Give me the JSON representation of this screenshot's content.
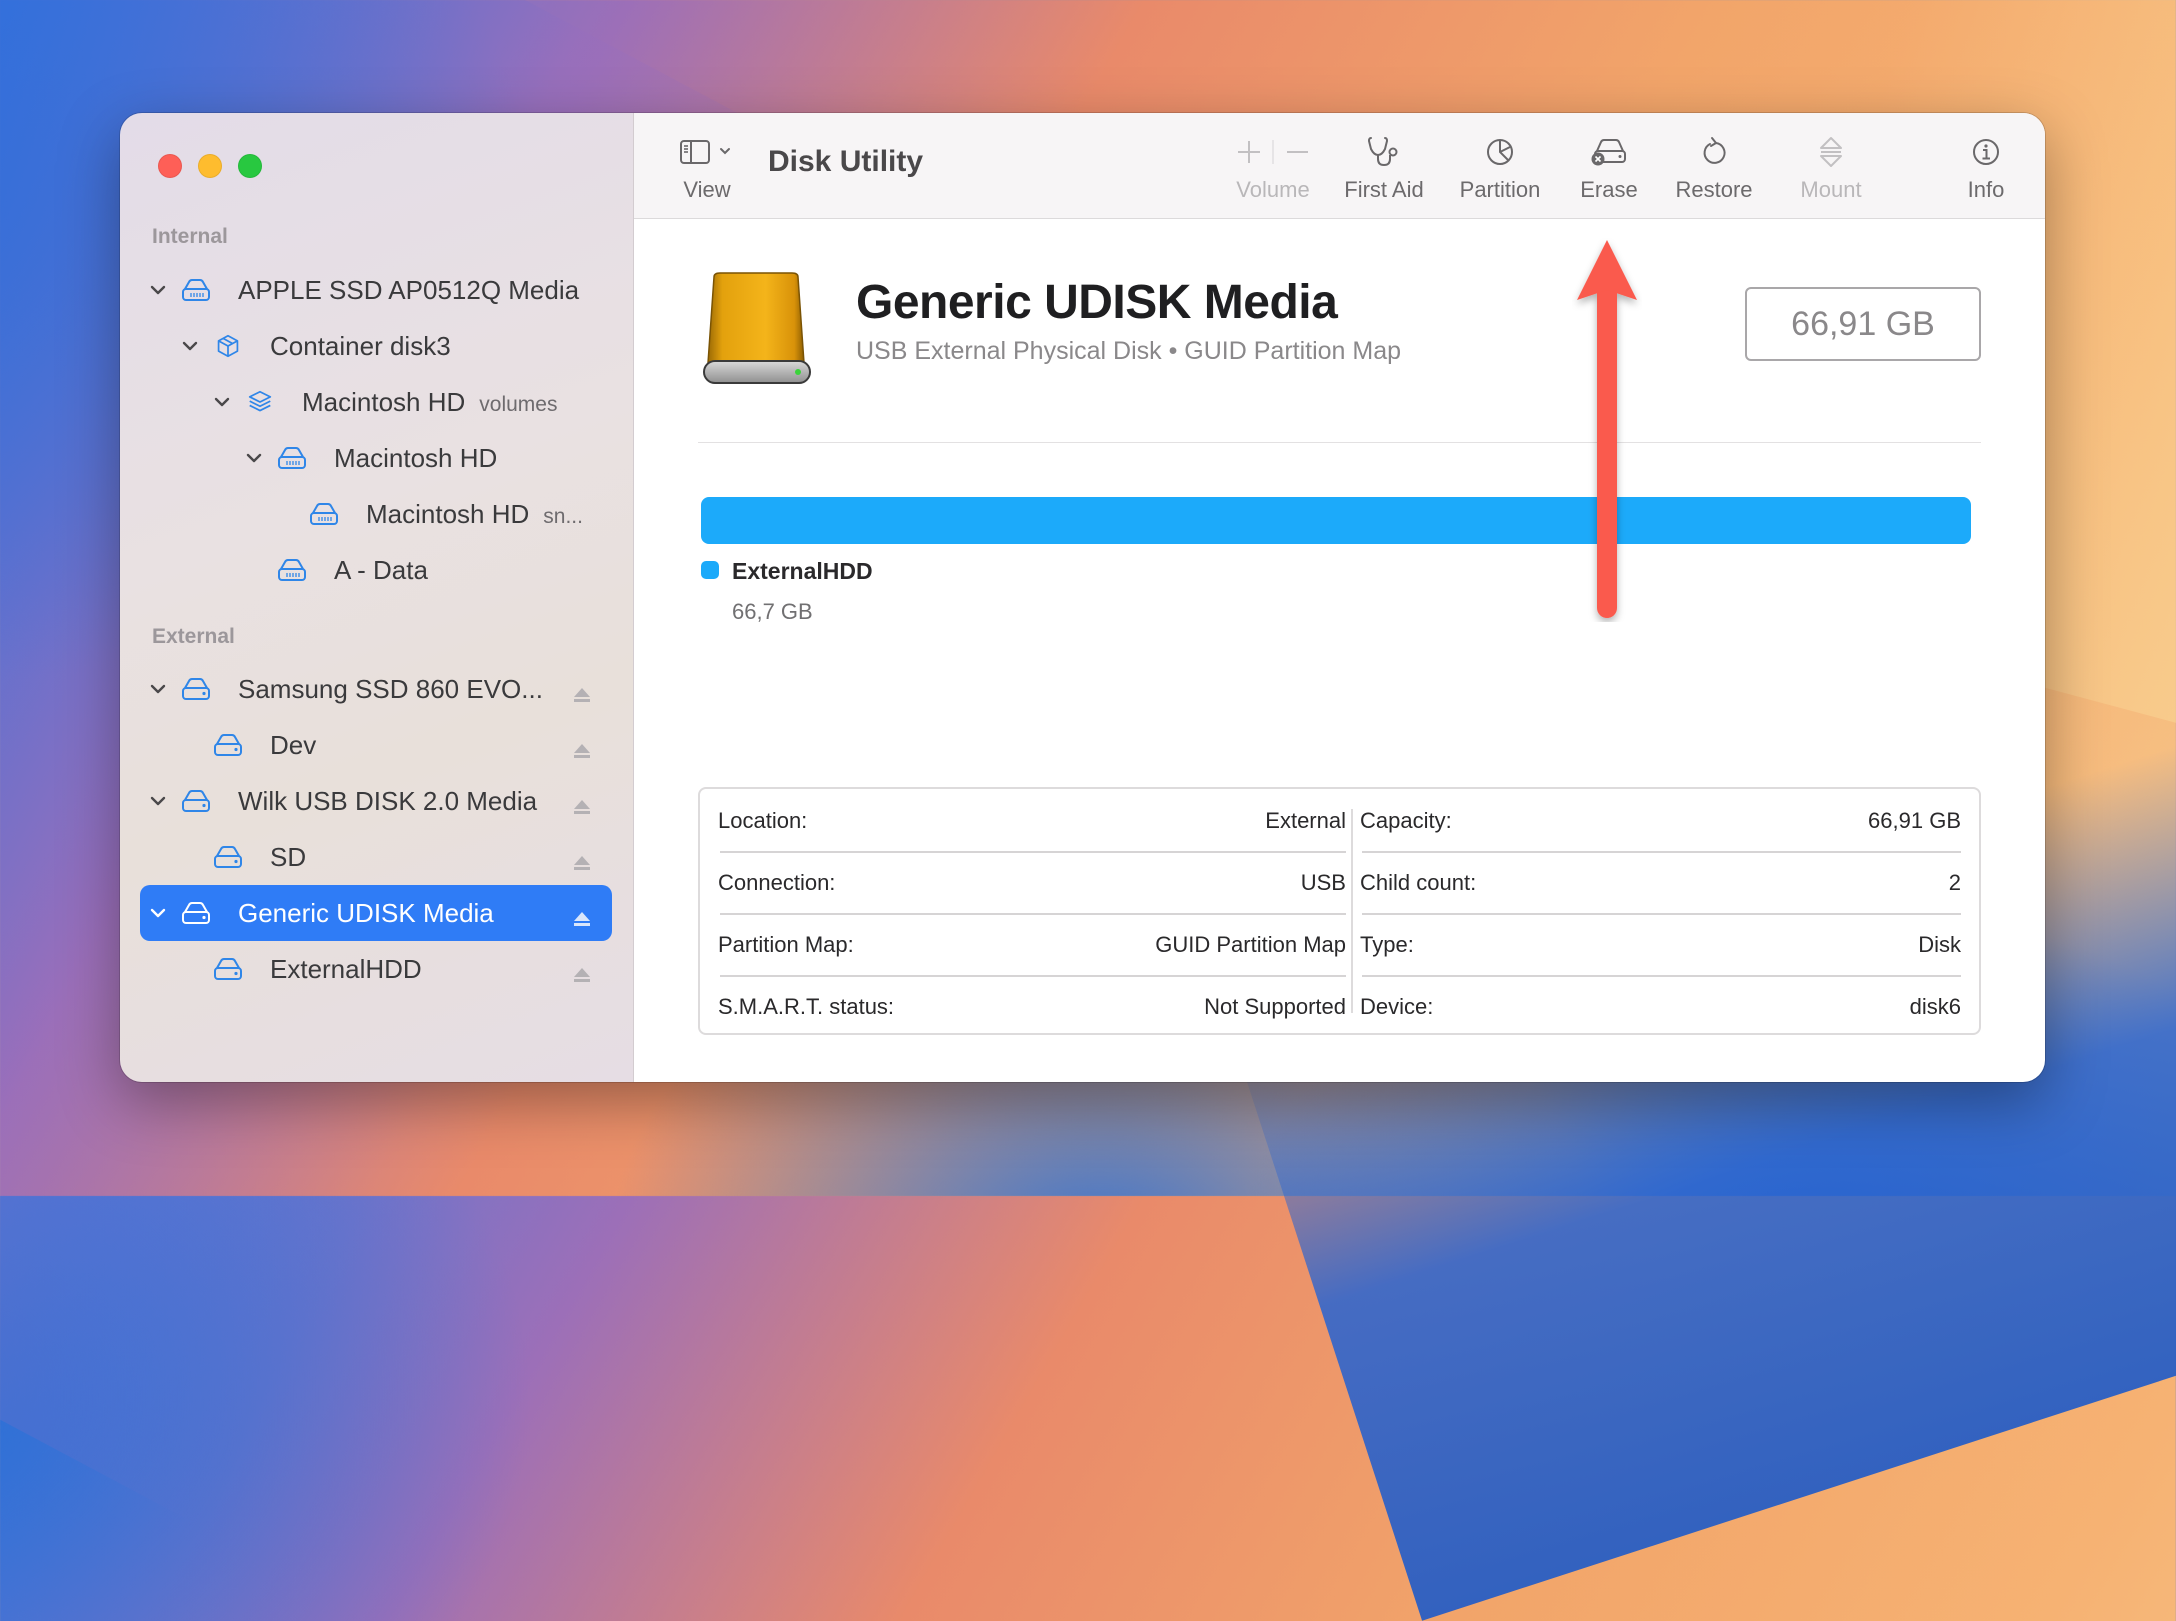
{
  "window": {
    "app_title": "Disk Utility",
    "traffic_lights": [
      "close",
      "minimize",
      "zoom"
    ]
  },
  "sidebar": {
    "sections": [
      {
        "label": "Internal",
        "items": [
          {
            "label": "APPLE SSD AP0512Q Media",
            "icon": "internal-drive-icon",
            "expanded": true,
            "level": 0
          },
          {
            "label": "Container disk3",
            "icon": "container-box-icon",
            "expanded": true,
            "level": 1
          },
          {
            "label": "Macintosh HD",
            "suffix": "volumes",
            "icon": "volume-group-stack-icon",
            "expanded": true,
            "level": 2
          },
          {
            "label": "Macintosh HD",
            "icon": "internal-drive-icon",
            "expanded": true,
            "level": 3
          },
          {
            "label": "Macintosh HD",
            "suffix": "sn...",
            "icon": "internal-drive-icon",
            "level": 4
          },
          {
            "label": "A - Data",
            "icon": "internal-drive-icon",
            "level": 3
          }
        ]
      },
      {
        "label": "External",
        "items": [
          {
            "label": "Samsung SSD 860 EVO...",
            "icon": "external-drive-icon",
            "expanded": true,
            "level": 0,
            "eject": true
          },
          {
            "label": "Dev",
            "icon": "external-drive-icon",
            "level": 1,
            "eject": true
          },
          {
            "label": "Wilk USB DISK 2.0 Media",
            "icon": "external-drive-icon",
            "expanded": true,
            "level": 0,
            "eject": true
          },
          {
            "label": "SD",
            "icon": "external-drive-icon",
            "level": 1,
            "eject": true
          },
          {
            "label": "Generic UDISK Media",
            "icon": "external-drive-icon",
            "expanded": true,
            "level": 0,
            "eject": true,
            "selected": true
          },
          {
            "label": "ExternalHDD",
            "icon": "external-drive-icon",
            "level": 1,
            "eject": true
          }
        ]
      }
    ]
  },
  "toolbar": {
    "view_label": "View",
    "volume_label": "Volume",
    "first_aid_label": "First Aid",
    "partition_label": "Partition",
    "erase_label": "Erase",
    "restore_label": "Restore",
    "mount_label": "Mount",
    "info_label": "Info"
  },
  "disk": {
    "name": "Generic UDISK Media",
    "subtitle": "USB External Physical Disk • GUID Partition Map",
    "capacity_badge": "66,91 GB"
  },
  "usage": {
    "partitions": [
      {
        "name": "ExternalHDD",
        "size": "66,7 GB",
        "color": "#1caafa",
        "fraction": 1.0
      }
    ]
  },
  "info": {
    "left": [
      {
        "label": "Location:",
        "value": "External"
      },
      {
        "label": "Connection:",
        "value": "USB"
      },
      {
        "label": "Partition Map:",
        "value": "GUID Partition Map"
      },
      {
        "label": "S.M.A.R.T. status:",
        "value": "Not Supported"
      }
    ],
    "right": [
      {
        "label": "Capacity:",
        "value": "66,91 GB"
      },
      {
        "label": "Child count:",
        "value": "2"
      },
      {
        "label": "Type:",
        "value": "Disk"
      },
      {
        "label": "Device:",
        "value": "disk6"
      }
    ]
  },
  "colors": {
    "accent": "#2f7cf6",
    "partition": "#1caafa",
    "annotation_arrow": "#fa5a4d",
    "icon_blue": "#2f86e8"
  },
  "annotation": {
    "type": "arrow",
    "points_to": "Erase"
  }
}
